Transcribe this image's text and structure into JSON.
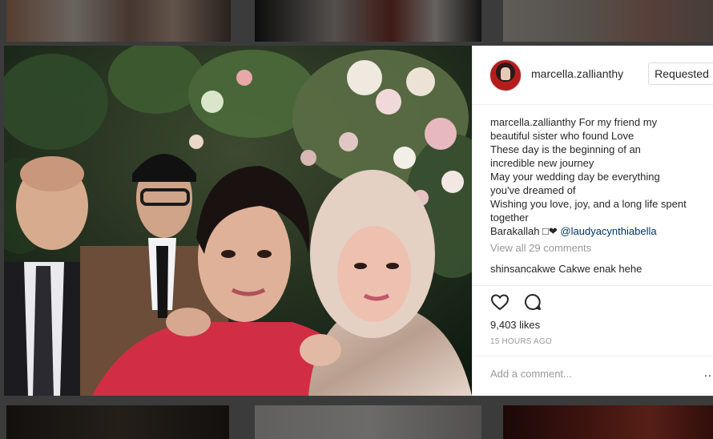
{
  "post": {
    "username": "marcella.zallianthy",
    "follow_button": "Requested",
    "caption_lines": [
      "For my friend my",
      "beautiful sister who found Love",
      "These day is the beginning of an",
      "incredible new journey",
      "May your wedding day be everything",
      "you've dreamed of",
      "Wishing you love, joy, and a long life spent",
      "together"
    ],
    "caption_last_prefix": "Barakallah □❤",
    "caption_mention": "@laudyacynthiabella",
    "view_all_comments": "View all 29 comments",
    "comments": [
      {
        "username": "shinsancakwe",
        "text": "Cakwe enak hehe"
      }
    ],
    "likes": "9,403 likes",
    "timestamp": "15 HOURS AGO",
    "add_comment_placeholder": "Add a comment...",
    "more_label": "…"
  },
  "icons": {
    "like": "heart-icon",
    "comment": "comment-icon",
    "more": "more-options-icon"
  },
  "colors": {
    "text": "#262626",
    "muted": "#999999",
    "mention": "#003569",
    "dress": "#d12d45"
  }
}
